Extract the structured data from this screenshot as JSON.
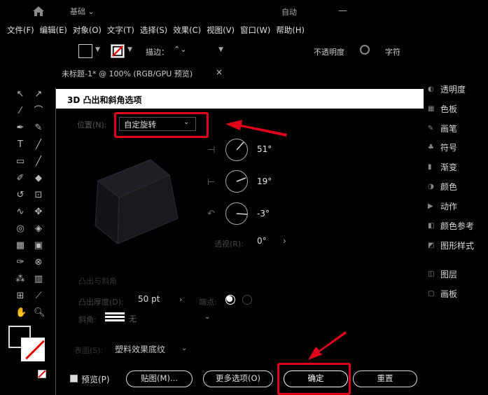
{
  "titlebar": {
    "workspace": "基础 ⌄",
    "auto_label": "自动",
    "min_icon": "—"
  },
  "menu": [
    "文件(F)",
    "编辑(E)",
    "对象(O)",
    "文字(T)",
    "选择(S)",
    "效果(C)",
    "视图(V)",
    "窗口(W)",
    "帮助(H)"
  ],
  "controlbar": {
    "stroke_label": "描边：",
    "stroke_stepper": "⌃⌄",
    "opacity_label": "不透明度",
    "char_label": "字符"
  },
  "document": {
    "tab": "未标题-1* @ 100% (RGB/GPU 预览)",
    "close": "×"
  },
  "right_panel": {
    "items": [
      "透明度",
      "色板",
      "画笔",
      "符号",
      "渐变",
      "颜色",
      "动作",
      "颜色参考",
      "图形样式",
      "图层",
      "画板"
    ]
  },
  "dialog": {
    "title": "3D 凸出和斜角选项",
    "position_label": "位置(N):",
    "position_value": "自定旋转",
    "rotation_x": "51°",
    "rotation_y": "19°",
    "rotation_z": "-3°",
    "perspective_label": "透视(R):",
    "perspective_value": "0°",
    "extrude_heading": "凸出与斜角",
    "depth_label": "凸出厚度(D):",
    "depth_value": "50 pt",
    "cap_label": "端点:",
    "bevel_label": "斜角:",
    "bevel_value": "无",
    "surface_label": "表面(S):",
    "surface_value": "塑料效果底纹",
    "preview_label": "预览(P)",
    "buttons": {
      "map": "贴图(M)...",
      "more": "更多选项(O)",
      "ok": "确定",
      "reset": "重置"
    }
  },
  "colors": {
    "highlight": "#e0001a",
    "dialog_title_bg": "#ffffff",
    "bg": "#000000"
  }
}
